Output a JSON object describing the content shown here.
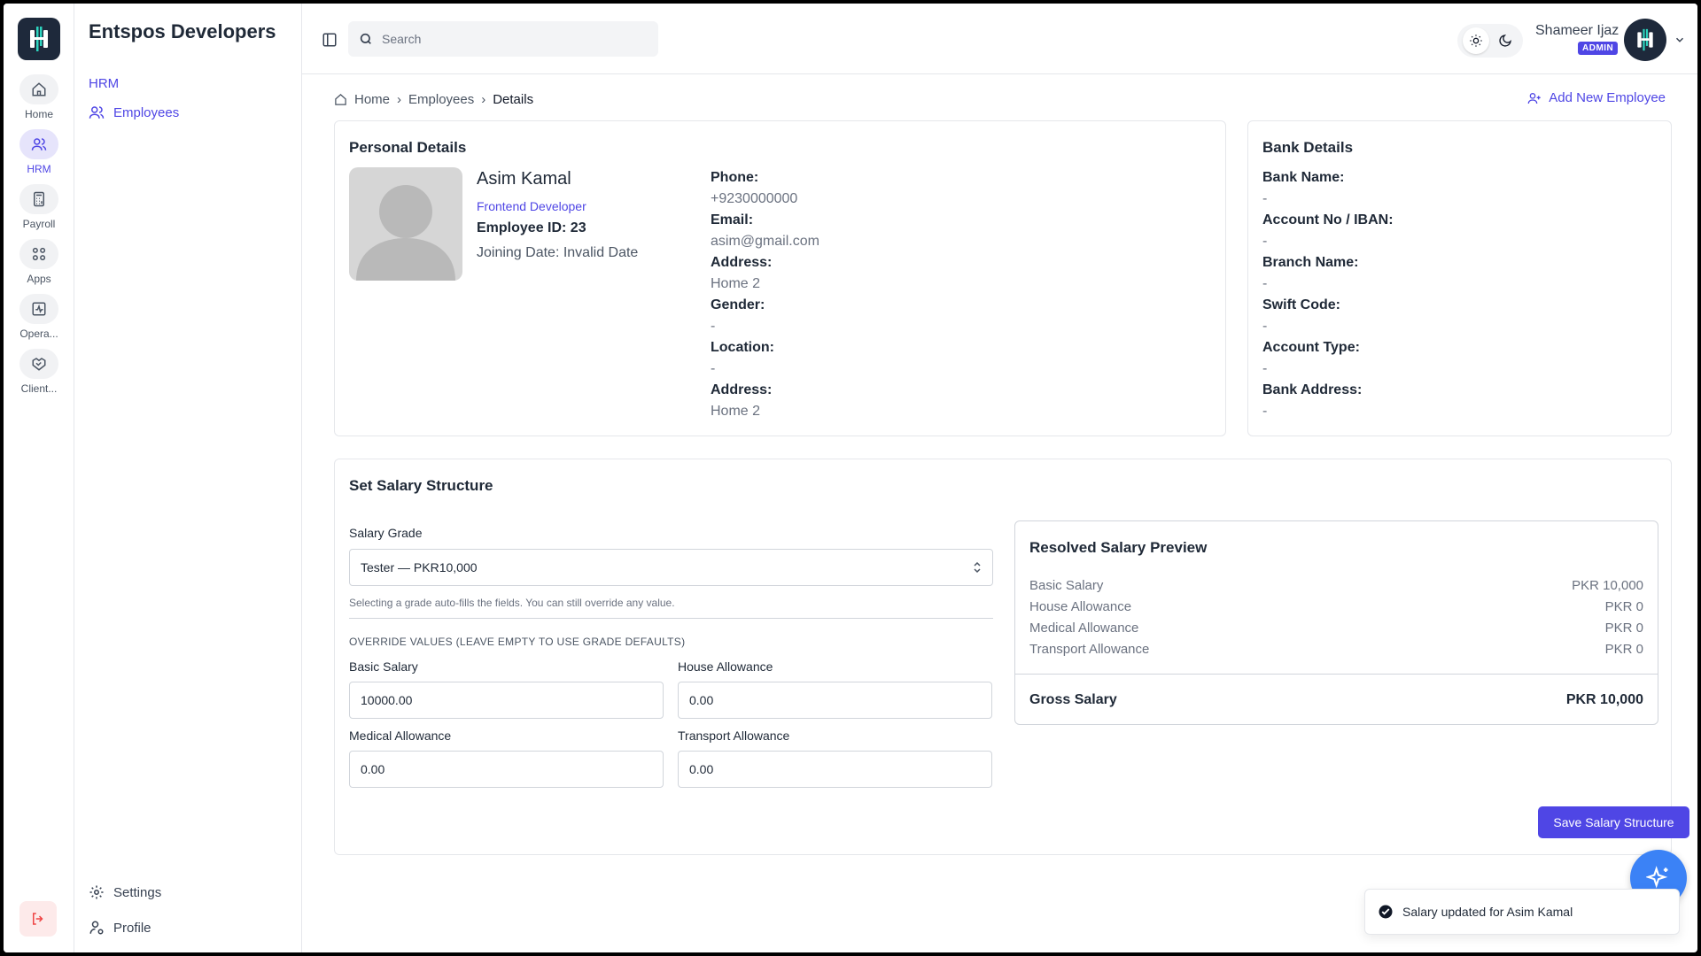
{
  "rail": {
    "items": [
      {
        "label": "Home",
        "icon": "home-icon"
      },
      {
        "label": "HRM",
        "icon": "users-icon"
      },
      {
        "label": "Payroll",
        "icon": "calculator-icon"
      },
      {
        "label": "Apps",
        "icon": "grid-icon"
      },
      {
        "label": "Opera...",
        "icon": "activity-icon"
      },
      {
        "label": "Client...",
        "icon": "handshake-icon"
      }
    ],
    "active": "HRM"
  },
  "sidebar": {
    "org_name": "Entspos Developers",
    "section": "HRM",
    "items": [
      {
        "label": "Employees"
      }
    ],
    "bottom": [
      {
        "label": "Settings"
      },
      {
        "label": "Profile"
      }
    ]
  },
  "topbar": {
    "search_placeholder": "Search",
    "user_name": "Shameer Ijaz",
    "role": "ADMIN"
  },
  "breadcrumb": [
    "Home",
    "Employees",
    "Details"
  ],
  "add_employee_label": "Add New Employee",
  "personal": {
    "title": "Personal Details",
    "name": "Asim Kamal",
    "role": "Frontend Developer",
    "employee_id": "Employee ID: 23",
    "joining": "Joining Date: Invalid Date",
    "fields": [
      {
        "label": "Phone:",
        "value": "+9230000000"
      },
      {
        "label": "Email:",
        "value": "asim@gmail.com"
      },
      {
        "label": "Address:",
        "value": "Home 2"
      },
      {
        "label": "Gender:",
        "value": "-"
      },
      {
        "label": "Location:",
        "value": "-"
      },
      {
        "label": "Address:",
        "value": "Home 2"
      }
    ]
  },
  "bank": {
    "title": "Bank Details",
    "fields": [
      {
        "label": "Bank Name:",
        "value": "-"
      },
      {
        "label": "Account No / IBAN:",
        "value": "-"
      },
      {
        "label": "Branch Name:",
        "value": "-"
      },
      {
        "label": "Swift Code:",
        "value": "-"
      },
      {
        "label": "Account Type:",
        "value": "-"
      },
      {
        "label": "Bank Address:",
        "value": "-"
      }
    ]
  },
  "salary": {
    "title": "Set Salary Structure",
    "grade_label": "Salary Grade",
    "grade_value": "Tester — PKR10,000",
    "hint": "Selecting a grade auto-fills the fields. You can still override any value.",
    "override_label": "OVERRIDE VALUES (LEAVE EMPTY TO USE GRADE DEFAULTS)",
    "basic_label": "Basic Salary",
    "basic_value": "10000.00",
    "house_label": "House Allowance",
    "house_value": "0.00",
    "medical_label": "Medical Allowance",
    "medical_value": "0.00",
    "transport_label": "Transport Allowance",
    "transport_value": "0.00",
    "save_label": "Save Salary Structure"
  },
  "preview": {
    "title": "Resolved Salary Preview",
    "rows": [
      {
        "label": "Basic Salary",
        "value": "PKR 10,000"
      },
      {
        "label": "House Allowance",
        "value": "PKR 0"
      },
      {
        "label": "Medical Allowance",
        "value": "PKR 0"
      },
      {
        "label": "Transport Allowance",
        "value": "PKR 0"
      }
    ],
    "gross_label": "Gross Salary",
    "gross_value": "PKR 10,000"
  },
  "toast": {
    "message": "Salary updated for Asim Kamal"
  },
  "colors": {
    "accent": "#4f46e5",
    "logo_bg": "#1e293b",
    "fab": "#3b82f6",
    "logout_bg": "#fdeaea",
    "logout_icon": "#ef4444"
  }
}
